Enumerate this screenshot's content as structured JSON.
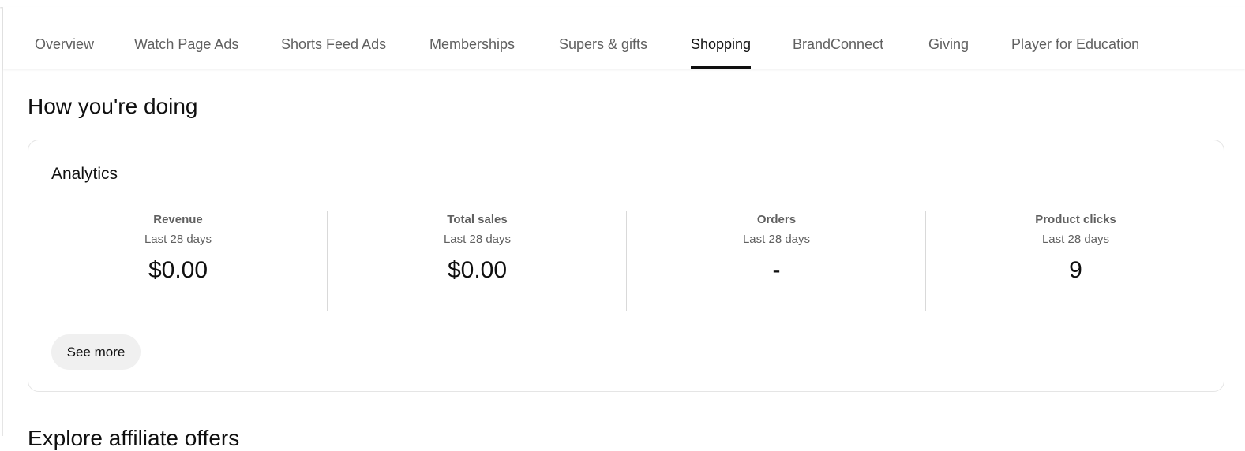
{
  "tabs": [
    {
      "label": "Overview"
    },
    {
      "label": "Watch Page Ads"
    },
    {
      "label": "Shorts Feed Ads"
    },
    {
      "label": "Memberships"
    },
    {
      "label": "Supers & gifts"
    },
    {
      "label": "Shopping",
      "active": true
    },
    {
      "label": "BrandConnect"
    },
    {
      "label": "Giving"
    },
    {
      "label": "Player for Education"
    }
  ],
  "section_title": "How you're doing",
  "analytics": {
    "title": "Analytics",
    "metrics": [
      {
        "label": "Revenue",
        "period": "Last 28 days",
        "value": "$0.00"
      },
      {
        "label": "Total sales",
        "period": "Last 28 days",
        "value": "$0.00"
      },
      {
        "label": "Orders",
        "period": "Last 28 days",
        "value": "-"
      },
      {
        "label": "Product clicks",
        "period": "Last 28 days",
        "value": "9"
      }
    ],
    "see_more_label": "See more"
  },
  "next_section_title": "Explore affiliate offers"
}
